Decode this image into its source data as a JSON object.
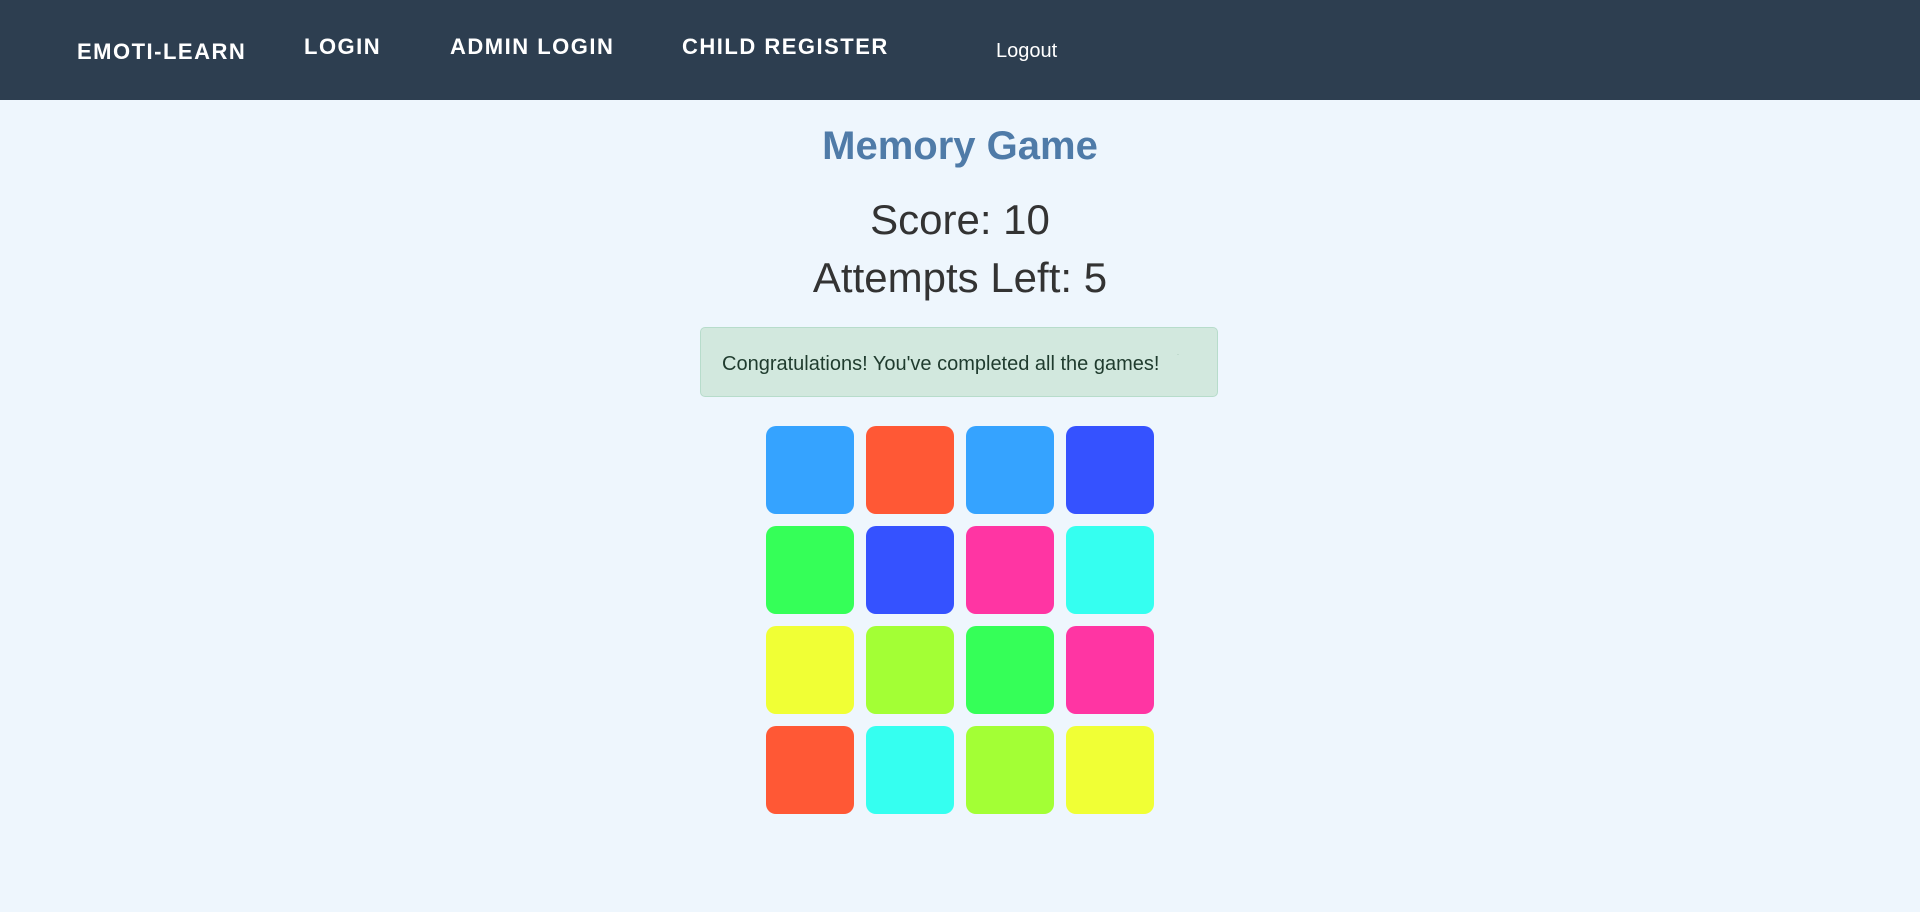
{
  "nav": {
    "brand": "EMOTI-LEARN",
    "login": "LOGIN",
    "admin_login": "ADMIN LOGIN",
    "child_register": "CHILD REGISTER",
    "logout": "Logout"
  },
  "game": {
    "title": "Memory Game",
    "score": "Score: 10",
    "attempts": "Attempts Left: 5",
    "message": "Congratulations! You've completed all the games!"
  },
  "colors": {
    "navbar_bg": "#2d3e50",
    "page_bg": "#eef6fd",
    "title": "#4f7ba8",
    "alert_bg": "#d2e8de"
  },
  "cards": [
    {
      "color": "#35a3ff"
    },
    {
      "color": "#ff5835"
    },
    {
      "color": "#35a3ff"
    },
    {
      "color": "#3552ff"
    },
    {
      "color": "#35ff58"
    },
    {
      "color": "#3552ff"
    },
    {
      "color": "#ff35a3"
    },
    {
      "color": "#35fff0"
    },
    {
      "color": "#f0ff35"
    },
    {
      "color": "#a3ff35"
    },
    {
      "color": "#35ff58"
    },
    {
      "color": "#ff35a3"
    },
    {
      "color": "#ff5835"
    },
    {
      "color": "#35fff0"
    },
    {
      "color": "#a3ff35"
    },
    {
      "color": "#f0ff35"
    }
  ]
}
